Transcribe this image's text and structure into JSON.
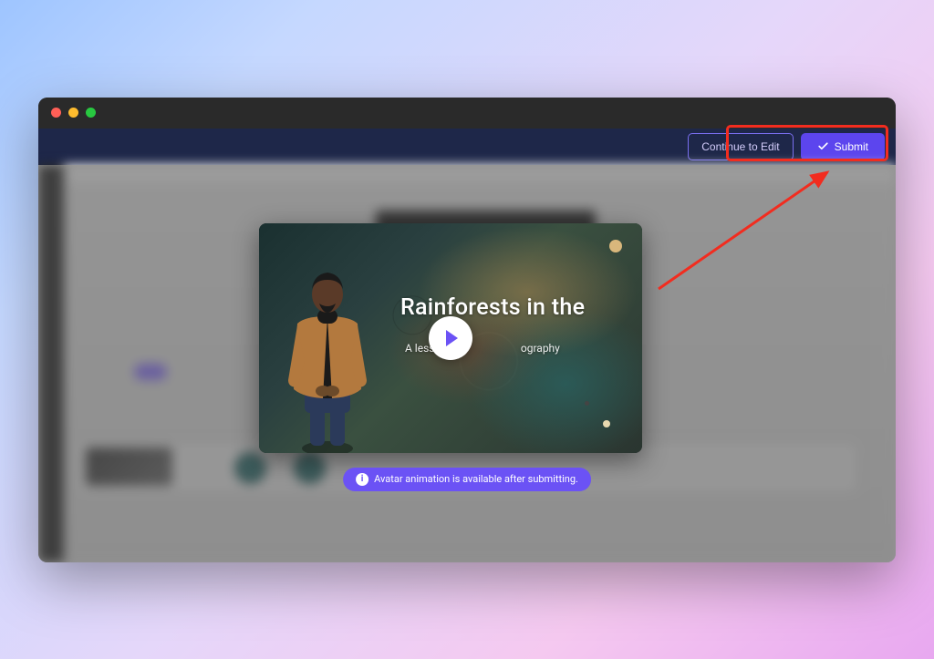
{
  "topbar": {
    "continue_label": "Continue to Edit",
    "submit_label": "Submit"
  },
  "preview": {
    "title": "Rainforests in the",
    "subtitle_left": "A lesser",
    "subtitle_right": "ography"
  },
  "info": {
    "message": "Avatar animation is available after submitting.",
    "icon_text": "i"
  },
  "colors": {
    "accent": "#5c45ee",
    "highlight": "#f22c1f"
  }
}
